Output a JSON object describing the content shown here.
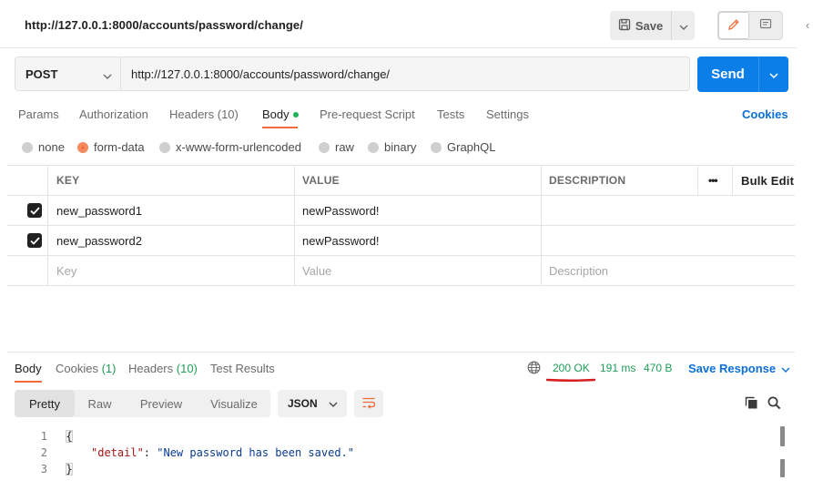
{
  "request": {
    "title_url": "http://127.0.0.1:8000/accounts/password/change/",
    "save_label": "Save",
    "method": "POST",
    "url": "http://127.0.0.1:8000/accounts/password/change/",
    "send_label": "Send"
  },
  "req_tabs": {
    "params": "Params",
    "authorization": "Authorization",
    "headers": "Headers (10)",
    "body": "Body",
    "prerequest": "Pre-request Script",
    "tests": "Tests",
    "settings": "Settings",
    "cookies": "Cookies"
  },
  "body_types": {
    "none": "none",
    "form_data": "form-data",
    "urlencoded": "x-www-form-urlencoded",
    "raw": "raw",
    "binary": "binary",
    "graphql": "GraphQL",
    "selected": "form-data"
  },
  "table": {
    "headers": {
      "key": "KEY",
      "value": "VALUE",
      "description": "DESCRIPTION",
      "more": "•••",
      "bulk_edit": "Bulk Edit"
    },
    "rows": [
      {
        "key": "new_password1",
        "value": "newPassword!",
        "description": "",
        "checked": true
      },
      {
        "key": "new_password2",
        "value": "newPassword!",
        "description": "",
        "checked": true
      }
    ],
    "placeholder": {
      "key": "Key",
      "value": "Value",
      "description": "Description"
    }
  },
  "response": {
    "tabs": {
      "body": "Body",
      "cookies": "Cookies",
      "cookies_count": "(1)",
      "headers": "Headers",
      "headers_count": "(10)",
      "test_results": "Test Results"
    },
    "status": "200 OK",
    "time": "191 ms",
    "size": "470 B",
    "save_response": "Save Response",
    "views": {
      "pretty": "Pretty",
      "raw": "Raw",
      "preview": "Preview",
      "visualize": "Visualize"
    },
    "language": "JSON",
    "code": {
      "line_numbers": [
        "1",
        "2",
        "3"
      ],
      "open": "{",
      "close": "}",
      "key": "\"detail\"",
      "sep": ": ",
      "value": "\"New password has been saved.\""
    }
  },
  "colors": {
    "accent": "#f26b3a",
    "primary": "#0b7ee8",
    "success": "#1f9d55",
    "annotation": "#d61f1f"
  }
}
